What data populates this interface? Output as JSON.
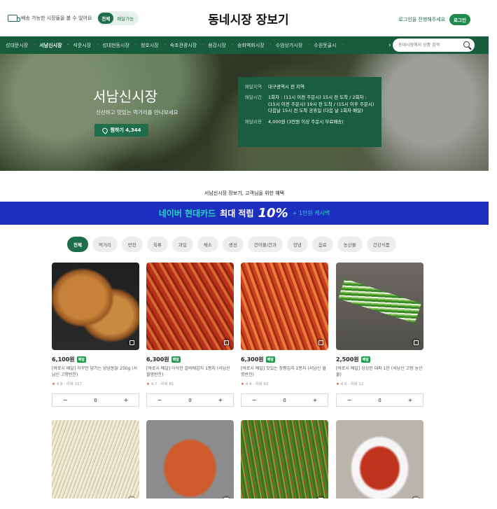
{
  "header": {
    "delivery_text": "배송 가능한 시장들을 볼 수 있어요",
    "toggle": [
      "전체",
      "배달가능"
    ],
    "brand": "동네시장 장보기",
    "login_prompt": "로그인을 진행해주세요",
    "login_button": "로그인"
  },
  "nav": {
    "items": [
      "성대문시장",
      "서남신시장",
      "석준시장",
      "성대현동시장",
      "청호시장",
      "속초관광시장",
      "용강시장",
      "송화벽화시장",
      "수암상가시장",
      "수원못골시"
    ],
    "active_index": 1,
    "search_placeholder": "동네시장에서 상품 검색"
  },
  "hero": {
    "title": "서남신시장",
    "subtitle": "신선하고 맛있는 먹거리를 만나보세요",
    "fav_label": "찜하기 4,344",
    "info": [
      {
        "label": "배달지역",
        "value": "대구광역시 전 지역"
      },
      {
        "label": "배달시간",
        "value": "1회차 : (11시 이전 주문시) 15시 전 도착 / 2회차 : (15시 이전 주문시) 19시 전 도착 / (15시 이후 주문시) 다음날 15시 전 도착 공휴일 (다음 날 1회차 배달)"
      },
      {
        "label": "배달비용",
        "value": "4,000원 (3만원 이상 주문시 무료배송)"
      }
    ]
  },
  "promo": {
    "text": "서남신시장 장보기, 고객님을 위한 혜택",
    "banner_brand": "네이버 현대카드",
    "banner_main": "최대 적립",
    "banner_pct": "10%",
    "banner_extra": "+ 1만원 캐시백"
  },
  "categories": [
    "전체",
    "먹거리",
    "반찬",
    "육류",
    "과일",
    "채소",
    "생선",
    "건어물/건과",
    "양념",
    "음료",
    "농산물",
    "건강식품"
  ],
  "products": [
    {
      "price": "6,100원",
      "badge": "배달",
      "name": "[바로시 배달] 자꾸만 당기는 양념통닭 250g (서남신 고향반찬)",
      "rating": "4.8",
      "reviews": "리뷰 117",
      "qty": "0"
    },
    {
      "price": "6,300원",
      "badge": "배달",
      "name": "[바로시 배달] 아삭한 갈비배김치 1봉지 (서남신 월명반찬)",
      "rating": "4.7",
      "reviews": "리뷰 81",
      "qty": "0"
    },
    {
      "price": "6,300원",
      "badge": "배달",
      "name": "[바로시 배달] 맛있는 창평김치 1봉지 (서남신 월명반찬)",
      "rating": "4.4",
      "reviews": "리뷰 62",
      "qty": "0"
    },
    {
      "price": "2,500원",
      "badge": "배달",
      "name": "[바로시 배달] 싱싱한 대파 1단 (서남신 고향 농산물)",
      "rating": "4.8",
      "reviews": "리뷰 12",
      "qty": "0"
    },
    {
      "price": "",
      "badge": "",
      "name": "",
      "rating": "",
      "reviews": "",
      "qty": ""
    },
    {
      "price": "",
      "badge": "",
      "name": "",
      "rating": "",
      "reviews": "",
      "qty": ""
    },
    {
      "price": "",
      "badge": "",
      "name": "",
      "rating": "",
      "reviews": "",
      "qty": ""
    },
    {
      "price": "",
      "badge": "",
      "name": "",
      "rating": "",
      "reviews": "",
      "qty": ""
    }
  ],
  "stepper": {
    "minus": "−",
    "plus": "+"
  },
  "colors": {
    "accent": "#1e6e4c",
    "nav": "#175c3c",
    "banner": "#1d2fbf"
  }
}
